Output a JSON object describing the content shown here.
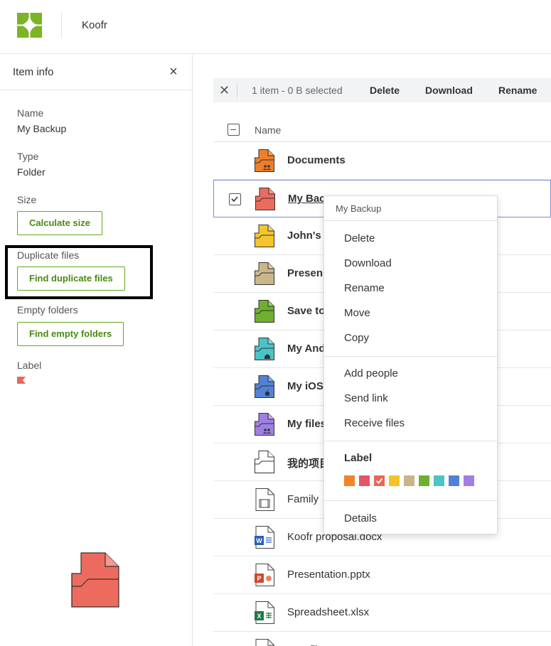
{
  "header": {
    "app_title": "Koofr"
  },
  "sidebar": {
    "title": "Item info",
    "name_label": "Name",
    "name_value": "My Backup",
    "type_label": "Type",
    "type_value": "Folder",
    "size_label": "Size",
    "calc_size_btn": "Calculate size",
    "dup_label": "Duplicate files",
    "dup_btn": "Find duplicate files",
    "empty_label": "Empty folders",
    "empty_btn": "Find empty folders",
    "label_label": "Label",
    "label_color": "#e9685a"
  },
  "selection_bar": {
    "count": "1 item - 0 B selected",
    "delete": "Delete",
    "download": "Download",
    "rename": "Rename"
  },
  "table": {
    "name_header": "Name",
    "rows": [
      {
        "name": "Documents",
        "icon": "folder-shared-orange-icon"
      },
      {
        "name": "My Bac",
        "icon": "folder-red-icon",
        "selected": true
      },
      {
        "name": "John's f",
        "icon": "folder-yellow-icon"
      },
      {
        "name": "Presen",
        "icon": "folder-tan-icon"
      },
      {
        "name": "Save to",
        "icon": "folder-green-icon"
      },
      {
        "name": "My And",
        "icon": "folder-android-icon"
      },
      {
        "name": "My iOS",
        "icon": "folder-ios-icon"
      },
      {
        "name": "My files",
        "icon": "folder-shared-purple-icon"
      },
      {
        "name": "我的项目",
        "icon": "folder-outline-icon"
      },
      {
        "name": "Family",
        "icon": "video-file-icon"
      },
      {
        "name": "Koofr proposal.docx",
        "icon": "word-file-icon"
      },
      {
        "name": "Presentation.pptx",
        "icon": "powerpoint-file-icon"
      },
      {
        "name": "Spreadsheet.xlsx",
        "icon": "excel-file-icon"
      },
      {
        "name": "Text file",
        "icon": "text-file-icon"
      }
    ]
  },
  "context_menu": {
    "title": "My Backup",
    "items_1": [
      "Delete",
      "Download",
      "Rename",
      "Move",
      "Copy"
    ],
    "items_2": [
      "Add people",
      "Send link",
      "Receive files"
    ],
    "label_heading": "Label",
    "colors": [
      "#f08428",
      "#e45567",
      "#e9685a",
      "#f2c428",
      "#c9b48a",
      "#6db02e",
      "#4cc3c8",
      "#5282d6",
      "#9f7fe5"
    ],
    "checked_color_index": 2,
    "details": "Details"
  }
}
